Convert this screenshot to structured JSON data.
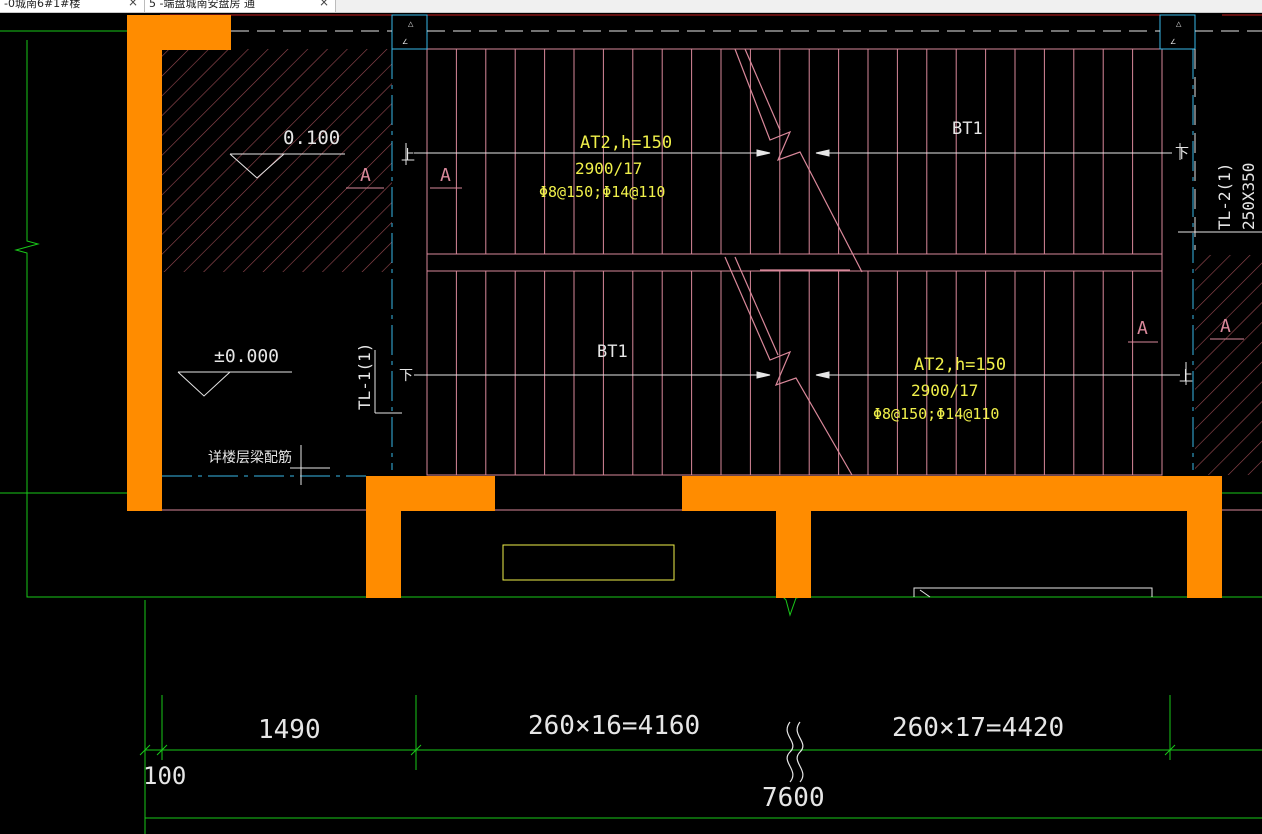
{
  "tabs": [
    {
      "label": "-0城南6#1#楼",
      "close": "×"
    },
    {
      "label": "5 -端盘城南安盘房 通",
      "close": "×"
    }
  ],
  "drawing": {
    "elev_upper": "0.100",
    "elev_lower": "±0.000",
    "section_mark": "A",
    "flight_at2": "AT2,h=150",
    "flight_at2_steps": "2900/17",
    "flight_at2_rebar": "Φ8@150;Φ14@110",
    "flight_bt1": "BT1",
    "beam_tl1": "TL-1(1)",
    "beam_tl2": "TL-2(1)",
    "beam_tl2_size": "250X350",
    "note": "详楼层梁配筋",
    "arrow_up": "上",
    "arrow_down": "下"
  },
  "dimensions": {
    "d1": "1490",
    "d2": "260×16=4160",
    "d3": "260×17=4420",
    "d0": "100",
    "total": "7600"
  },
  "colors": {
    "background": "#000000",
    "wall": "#ff8c00",
    "pink": "#d9889a",
    "red_line": "#c81e1e",
    "green": "#19c819",
    "yellow": "#f0f04a",
    "white": "#e6e6e6",
    "cyan": "#38b8e8",
    "hatch": "#9a4b52"
  }
}
